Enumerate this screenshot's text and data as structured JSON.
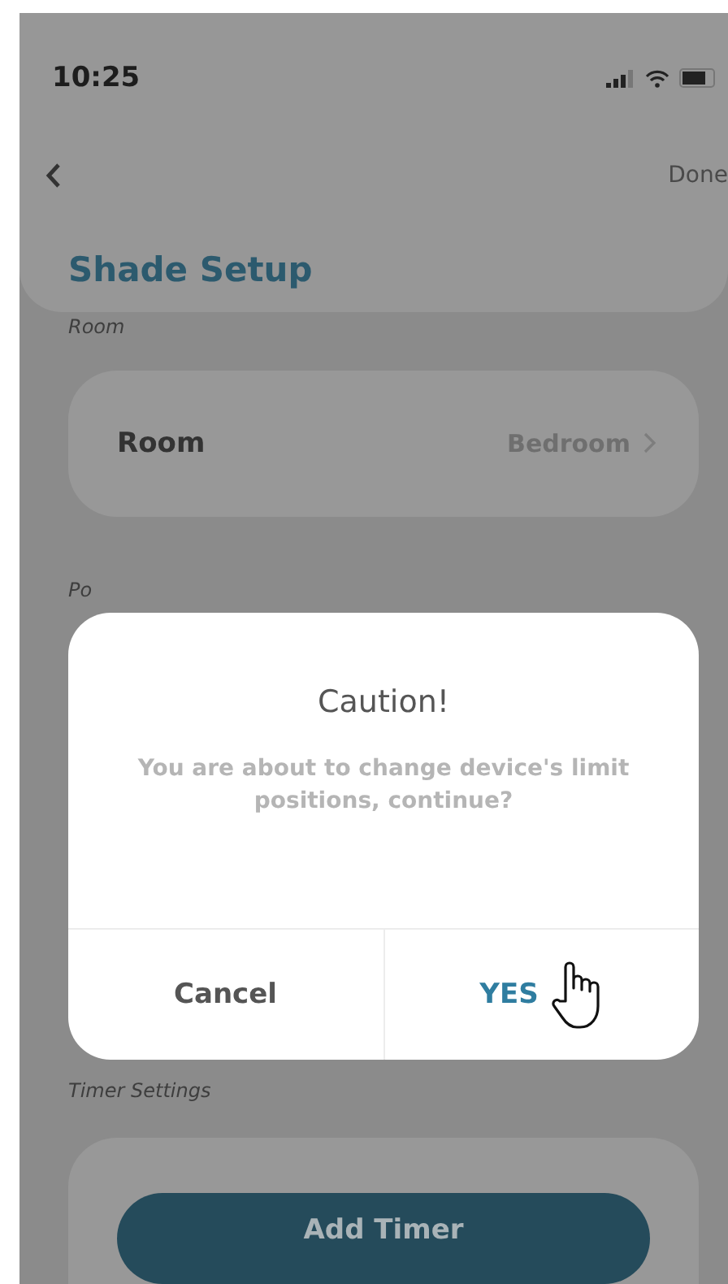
{
  "status_bar": {
    "time": "10:25"
  },
  "nav": {
    "done": "Done"
  },
  "header": {
    "title": "Shade Setup"
  },
  "room_section": {
    "label": "Room",
    "row": {
      "label": "Room",
      "value": "Bedroom"
    }
  },
  "position_section": {
    "label": "Po"
  },
  "timer_section": {
    "label": "Timer Settings",
    "button": "Add Timer"
  },
  "dialog": {
    "title": "Caution!",
    "message": "You are about to change device's limit positions, continue?",
    "buttons": [
      {
        "label": "Cancel",
        "kind": "cancel"
      },
      {
        "label": "YES",
        "kind": "confirm"
      }
    ]
  }
}
